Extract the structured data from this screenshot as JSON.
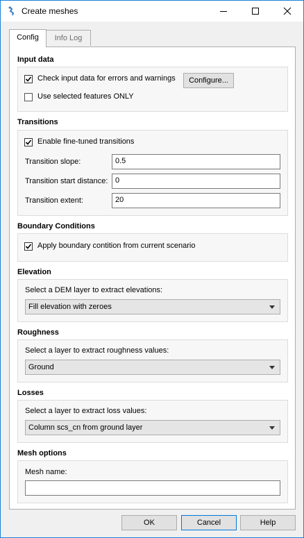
{
  "window": {
    "title": "Create meshes",
    "minimize_icon": "minimize-icon",
    "maximize_icon": "maximize-icon",
    "close_icon": "close-icon"
  },
  "tabs": [
    {
      "label": "Config",
      "active": true
    },
    {
      "label": "Info Log",
      "active": false
    }
  ],
  "input_data": {
    "title": "Input data",
    "check_errors": {
      "label": "Check input data for errors and warnings",
      "checked": true
    },
    "configure_button": "Configure...",
    "selected_only": {
      "label": "Use selected features ONLY",
      "checked": false
    }
  },
  "transitions": {
    "title": "Transitions",
    "fine_tuned": {
      "label": "Enable fine-tuned transitions",
      "checked": true
    },
    "slope": {
      "label": "Transition slope:",
      "value": "0.5"
    },
    "start_distance": {
      "label": "Transition start distance:",
      "value": "0"
    },
    "extent": {
      "label": "Transition extent:",
      "value": "20"
    }
  },
  "boundary": {
    "title": "Boundary Conditions",
    "apply": {
      "label": "Apply boundary contition from current scenario",
      "checked": true
    }
  },
  "elevation": {
    "title": "Elevation",
    "prompt": "Select a DEM layer to extract elevations:",
    "selected": "Fill elevation with zeroes"
  },
  "roughness": {
    "title": "Roughness",
    "prompt": "Select a layer to extract roughness values:",
    "selected": "Ground"
  },
  "losses": {
    "title": "Losses",
    "prompt": "Select a layer to extract loss values:",
    "selected": "Column scs_cn from ground layer"
  },
  "mesh_options": {
    "title": "Mesh options",
    "name_label": "Mesh name:",
    "name_value": ""
  },
  "footer": {
    "ok": "OK",
    "cancel": "Cancel",
    "help": "Help"
  },
  "colors": {
    "accent": "#1883d7",
    "check": "#000000"
  }
}
